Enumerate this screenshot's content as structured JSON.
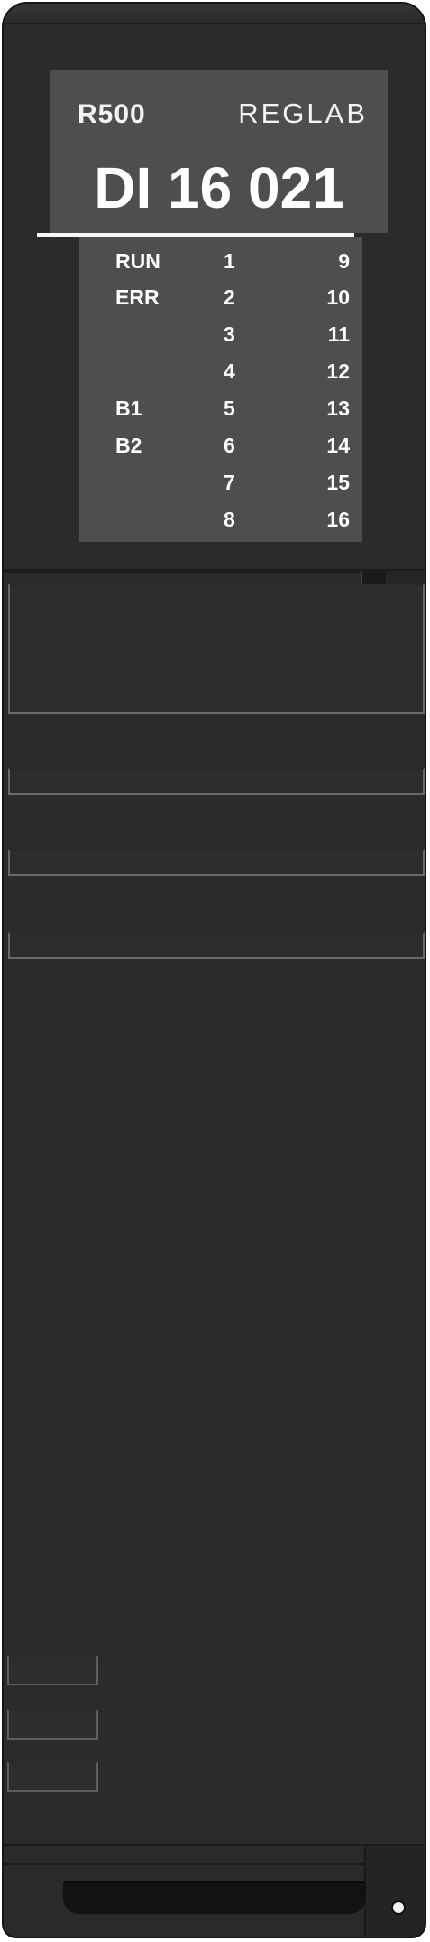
{
  "label": {
    "model": "R500",
    "brand": "REGLAB",
    "title": "DI 16 021"
  },
  "io_rows": [
    {
      "left": "RUN",
      "mid": "1",
      "right": "9"
    },
    {
      "left": "ERR",
      "mid": "2",
      "right": "10"
    },
    {
      "left": "",
      "mid": "3",
      "right": "11"
    },
    {
      "left": "",
      "mid": "4",
      "right": "12"
    },
    {
      "left": "B1",
      "mid": "5",
      "right": "13"
    },
    {
      "left": "B2",
      "mid": "6",
      "right": "14"
    },
    {
      "left": "",
      "mid": "7",
      "right": "15"
    },
    {
      "left": "",
      "mid": "8",
      "right": "16"
    }
  ],
  "colors": {
    "housing": "#2b2b2c",
    "label_panel": "#4e4e50",
    "text": "#ffffff"
  }
}
